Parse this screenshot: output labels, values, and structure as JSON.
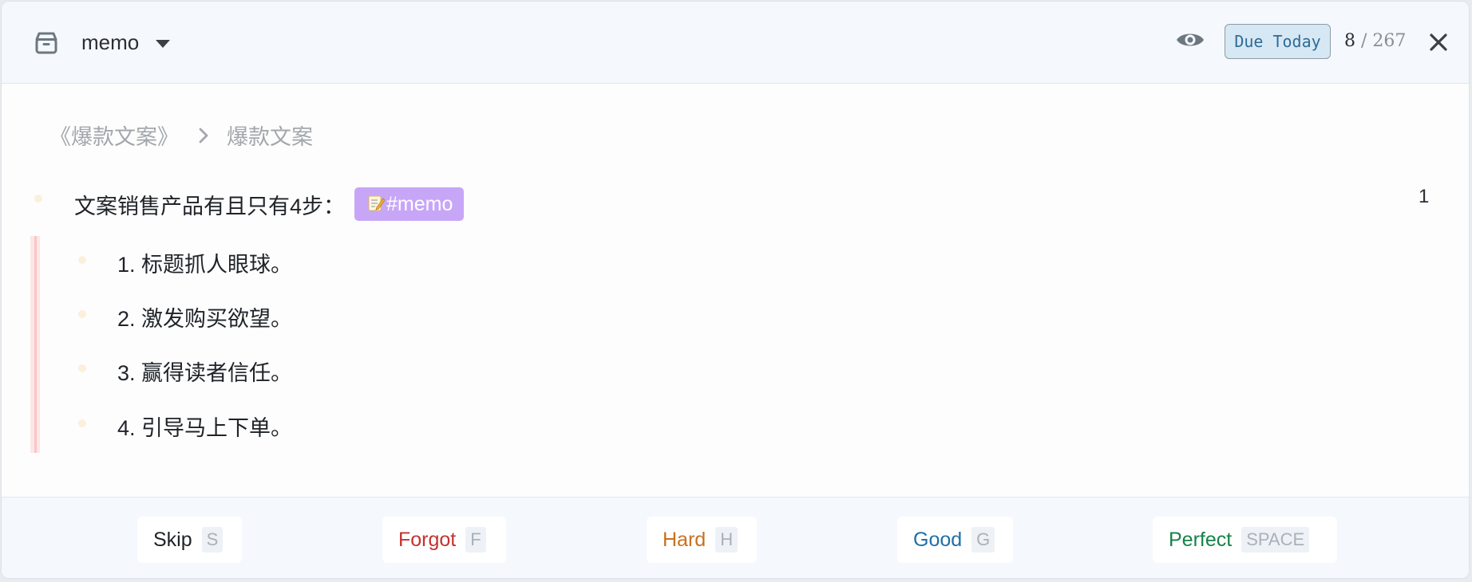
{
  "header": {
    "deck_name": "memo",
    "due_today_label": "Due Today",
    "progress_current": "8",
    "progress_separator": "/",
    "progress_total": "267",
    "icons": [
      "archive-box-icon",
      "caret-down-icon",
      "eye-icon",
      "close-icon"
    ]
  },
  "breadcrumb": {
    "page": "《爆款文案》",
    "block": "爆款文案"
  },
  "card": {
    "main_text": "文案销售产品有且只有4步：",
    "tag": "#memo",
    "ref_count": "1",
    "children": [
      "1. 标题抓人眼球。",
      "2. 激发购买欲望。",
      "3. 赢得读者信任。",
      "4. 引导马上下单。"
    ]
  },
  "footer": {
    "buttons": [
      {
        "label": "Skip",
        "key": "S"
      },
      {
        "label": "Forgot",
        "key": "F"
      },
      {
        "label": "Hard",
        "key": "H"
      },
      {
        "label": "Good",
        "key": "G"
      },
      {
        "label": "Perfect",
        "key": "SPACE"
      }
    ]
  },
  "colors": {
    "tag_bg": "#c7a6f8",
    "forgot": "#c4312f",
    "hard": "#c9711e",
    "good": "#1e6fa8",
    "perfect": "#16824a",
    "due_today_bg": "#d7e8f5"
  }
}
